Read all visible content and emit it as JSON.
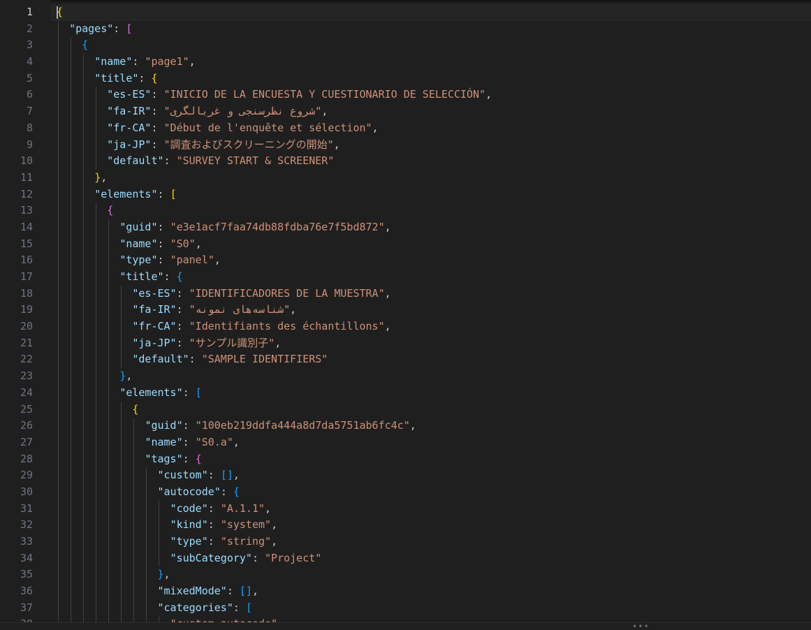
{
  "editor": {
    "language": "json",
    "active_line": 1,
    "lines": [
      "{",
      "  \"pages\": [",
      "    {",
      "      \"name\": \"page1\",",
      "      \"title\": {",
      "        \"es-ES\": \"INICIO DE LA ENCUESTA Y CUESTIONARIO DE SELECCIÓN\",",
      "        \"fa-IR\": \"شروع نظرسنجی و غربالگری\",",
      "        \"fr-CA\": \"Début de l'enquête et sélection\",",
      "        \"ja-JP\": \"調査およびスクリーニングの開始\",",
      "        \"default\": \"SURVEY START & SCREENER\"",
      "      },",
      "      \"elements\": [",
      "        {",
      "          \"guid\": \"e3e1acf7faa74db88fdba76e7f5bd872\",",
      "          \"name\": \"S0\",",
      "          \"type\": \"panel\",",
      "          \"title\": {",
      "            \"es-ES\": \"IDENTIFICADORES DE LA MUESTRA\",",
      "            \"fa-IR\": \"شناسه‌های نمونه\",",
      "            \"fr-CA\": \"Identifiants des échantillons\",",
      "            \"ja-JP\": \"サンプル識別子\",",
      "            \"default\": \"SAMPLE IDENTIFIERS\"",
      "          },",
      "          \"elements\": [",
      "            {",
      "              \"guid\": \"100eb219ddfa444a8d7da5751ab6fc4c\",",
      "              \"name\": \"S0.a\",",
      "              \"tags\": {",
      "                \"custom\": [],",
      "                \"autocode\": {",
      "                  \"code\": \"A.1.1\",",
      "                  \"kind\": \"system\",",
      "                  \"type\": \"string\",",
      "                  \"subCategory\": \"Project\"",
      "                },",
      "                \"mixedMode\": [],",
      "                \"categories\": [",
      "                  \"custom_autocode\","
    ]
  },
  "colors": {
    "background": "#1f1f1f",
    "key": "#9cdcfe",
    "string": "#ce9178",
    "punctuation": "#cccccc",
    "line_number": "#6e7681",
    "bracket_level_1": "#ffd700",
    "bracket_level_2": "#da70d6",
    "bracket_level_3": "#179fff"
  }
}
